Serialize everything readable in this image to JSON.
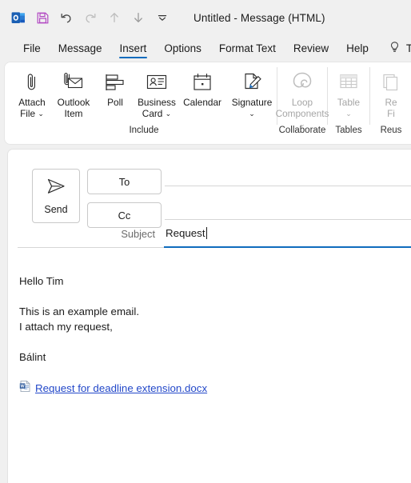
{
  "titlebar": {
    "app_icon": "outlook-icon",
    "quick_access": [
      {
        "name": "save-icon",
        "label": "Save",
        "disabled": false
      },
      {
        "name": "undo-icon",
        "label": "Undo",
        "disabled": false
      },
      {
        "name": "redo-icon",
        "label": "Redo",
        "disabled": true
      },
      {
        "name": "previous-item-icon",
        "label": "Previous Item",
        "disabled": true
      },
      {
        "name": "next-item-icon",
        "label": "Next Item",
        "disabled": false
      },
      {
        "name": "customize-quick-access-icon",
        "label": "Customize Quick Access Toolbar",
        "disabled": false
      }
    ],
    "title": "Untitled  -  Message (HTML)"
  },
  "tabs": [
    {
      "label": "File",
      "active": false
    },
    {
      "label": "Message",
      "active": false
    },
    {
      "label": "Insert",
      "active": true
    },
    {
      "label": "Options",
      "active": false
    },
    {
      "label": "Format Text",
      "active": false
    },
    {
      "label": "Review",
      "active": false
    },
    {
      "label": "Help",
      "active": false
    }
  ],
  "tell_me": {
    "icon": "lightbulb-icon",
    "label": "Te"
  },
  "ribbon": {
    "groups": [
      {
        "label": "Include",
        "disabled": false,
        "items": [
          {
            "name": "attach-file",
            "label": "Attach\nFile",
            "icon": "paperclip-icon",
            "dropdown": true,
            "disabled": false
          },
          {
            "name": "outlook-item",
            "label": "Outlook\nItem",
            "icon": "envelope-clip-icon",
            "dropdown": false,
            "disabled": false
          },
          {
            "name": "poll",
            "label": "Poll",
            "icon": "poll-bars-icon",
            "dropdown": false,
            "disabled": false
          },
          {
            "name": "business-card",
            "label": "Business\nCard",
            "icon": "contact-card-icon",
            "dropdown": true,
            "disabled": false
          },
          {
            "name": "calendar",
            "label": "Calendar",
            "icon": "calendar-icon",
            "dropdown": false,
            "disabled": false
          },
          {
            "name": "signature",
            "label": "Signature",
            "icon": "signature-pen-icon",
            "dropdown": true,
            "disabled": false
          }
        ]
      },
      {
        "label": "Collaborate",
        "disabled": true,
        "items": [
          {
            "name": "loop-components",
            "label": "Loop\nComponents",
            "icon": "loop-icon",
            "dropdown": true,
            "disabled": true
          }
        ]
      },
      {
        "label": "Tables",
        "disabled": true,
        "items": [
          {
            "name": "table",
            "label": "Table",
            "icon": "table-grid-icon",
            "dropdown": true,
            "disabled": true
          }
        ]
      },
      {
        "label": "Reus",
        "disabled": true,
        "items": [
          {
            "name": "reusable-files",
            "label": "Re\nFi",
            "icon": "reusable-files-icon",
            "dropdown": false,
            "disabled": true
          }
        ]
      }
    ]
  },
  "compose": {
    "send_label": "Send",
    "send_icon": "paper-plane-icon",
    "to_label": "To",
    "cc_label": "Cc",
    "to_value": "",
    "cc_value": "",
    "subject_label": "Subject",
    "subject_value": "Request",
    "subject_focused": true
  },
  "body": {
    "lines": [
      "Hello Tim",
      "",
      "This is an example email.",
      "I attach my request,",
      "",
      "Bálint"
    ],
    "attachment": {
      "icon": "word-doc-icon",
      "name": "Request for deadline extension.docx"
    }
  },
  "colors": {
    "accent_blue": "#0f6cbd",
    "link_blue": "#2348c9",
    "window_bg": "#f0f0f0",
    "panel_bg": "#ffffff",
    "save_purple": "#b146c2"
  }
}
